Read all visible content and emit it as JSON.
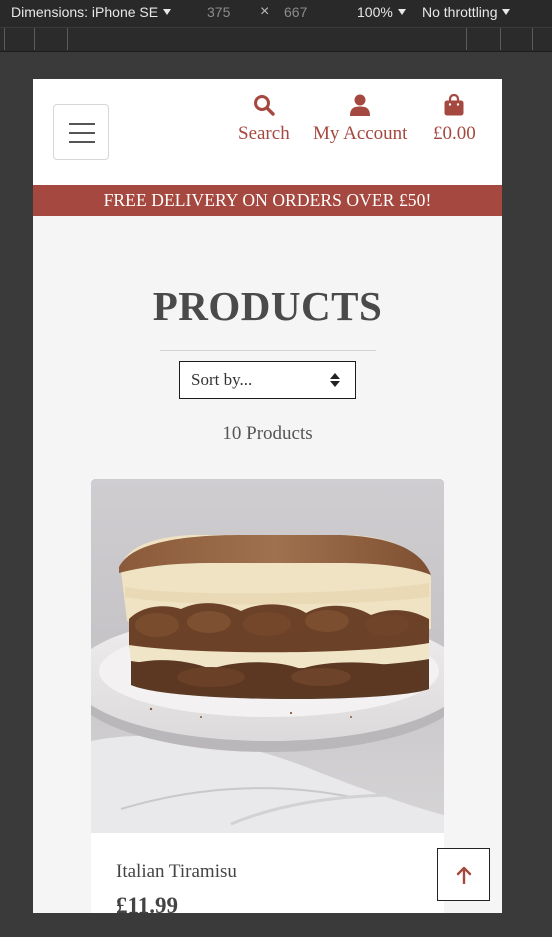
{
  "devtools": {
    "device_label": "Dimensions: iPhone SE",
    "width": "375",
    "times": "×",
    "height": "667",
    "zoom": "100%",
    "throttling": "No throttling"
  },
  "header": {
    "search_label": "Search",
    "account_label": "My Account",
    "cart_total": "£0.00",
    "accent_color": "#a5483f"
  },
  "banner": {
    "text": "FREE DELIVERY ON ORDERS OVER £50!"
  },
  "main": {
    "title": "PRODUCTS",
    "sort_placeholder": "Sort by...",
    "product_count": "10 Products"
  },
  "products": [
    {
      "name": "Italian Tiramisu",
      "price": "£11.99"
    }
  ]
}
